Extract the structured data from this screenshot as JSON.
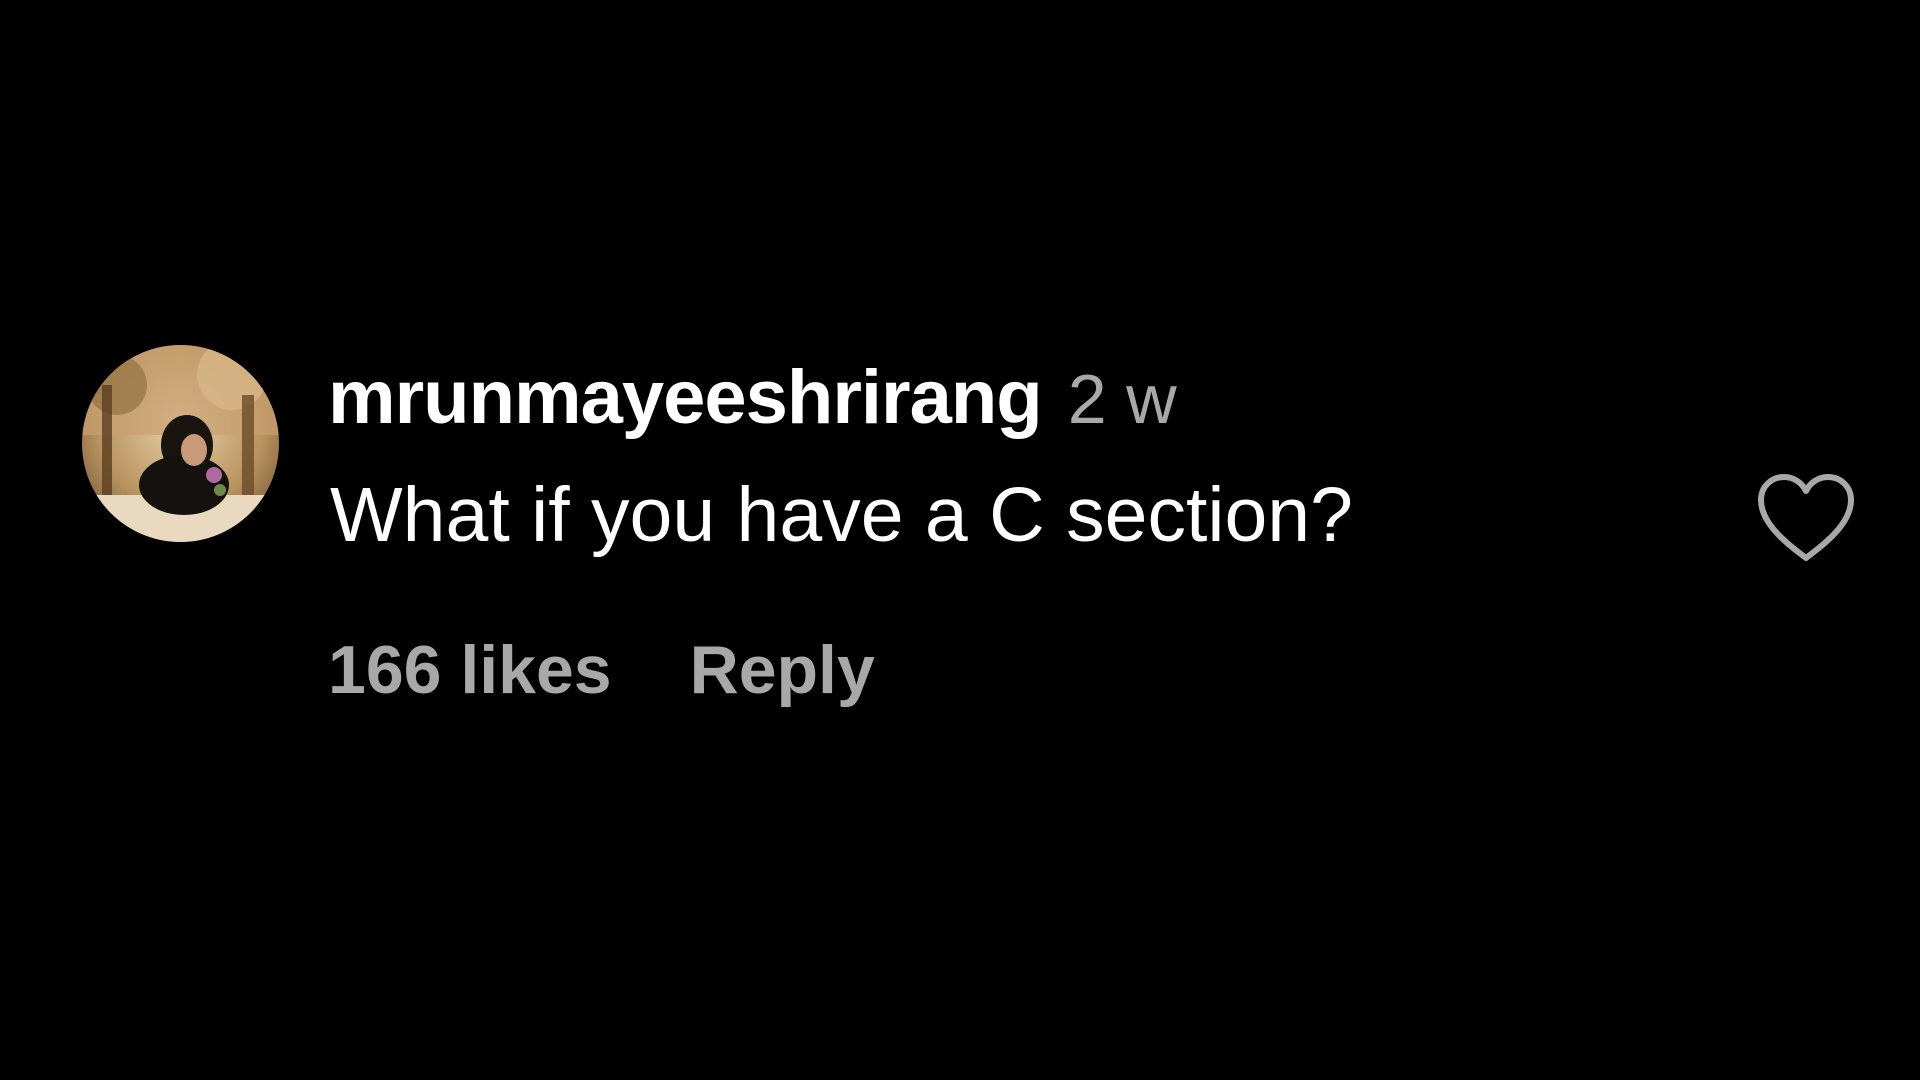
{
  "comment": {
    "username": "mrunmayeeshrirang",
    "timestamp": "2 w",
    "text": "What if you have a C section?",
    "likes_label": "166 likes",
    "reply_label": "Reply",
    "avatar_icon": "user-profile-photo",
    "like_icon": "heart-outline-icon"
  },
  "colors": {
    "background": "#000000",
    "primary_text": "#ffffff",
    "secondary_text": "#a8a8a8"
  }
}
